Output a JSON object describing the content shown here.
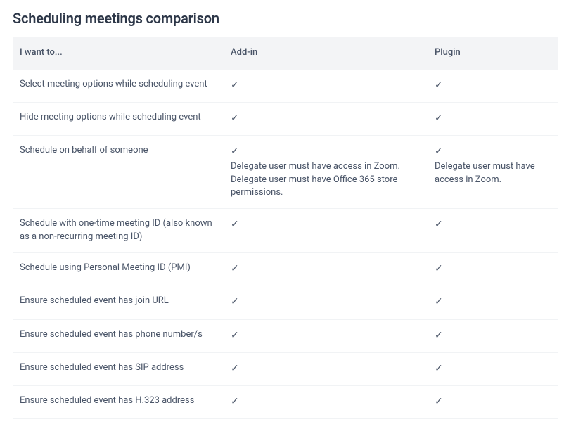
{
  "title": "Scheduling meetings comparison",
  "headers": {
    "feature": "I want to...",
    "addin": "Add-in",
    "plugin": "Plugin"
  },
  "checkmark": "✓",
  "rows": [
    {
      "feature": "Select meeting options while scheduling event",
      "addin_check": true,
      "addin_note": "",
      "plugin_check": true,
      "plugin_note": ""
    },
    {
      "feature": "Hide meeting options while scheduling event",
      "addin_check": true,
      "addin_note": "",
      "plugin_check": true,
      "plugin_note": ""
    },
    {
      "feature": "Schedule on behalf of someone",
      "addin_check": true,
      "addin_note": "Delegate user must have access in Zoom. Delegate user must have Office 365 store permissions.",
      "plugin_check": true,
      "plugin_note": "Delegate user must have access in Zoom."
    },
    {
      "feature": "Schedule with one-time meeting ID (also known as a non-recurring meeting ID)",
      "addin_check": true,
      "addin_note": "",
      "plugin_check": true,
      "plugin_note": ""
    },
    {
      "feature": "Schedule using Personal Meeting ID (PMI)",
      "addin_check": true,
      "addin_note": "",
      "plugin_check": true,
      "plugin_note": ""
    },
    {
      "feature": "Ensure scheduled event has join URL",
      "addin_check": true,
      "addin_note": "",
      "plugin_check": true,
      "plugin_note": ""
    },
    {
      "feature": "Ensure scheduled event has phone number/s",
      "addin_check": true,
      "addin_note": "",
      "plugin_check": true,
      "plugin_note": ""
    },
    {
      "feature": "Ensure scheduled event has SIP address",
      "addin_check": true,
      "addin_note": "",
      "plugin_check": true,
      "plugin_note": ""
    },
    {
      "feature": "Ensure scheduled event has H.323 address",
      "addin_check": true,
      "addin_note": "",
      "plugin_check": true,
      "plugin_note": ""
    }
  ]
}
